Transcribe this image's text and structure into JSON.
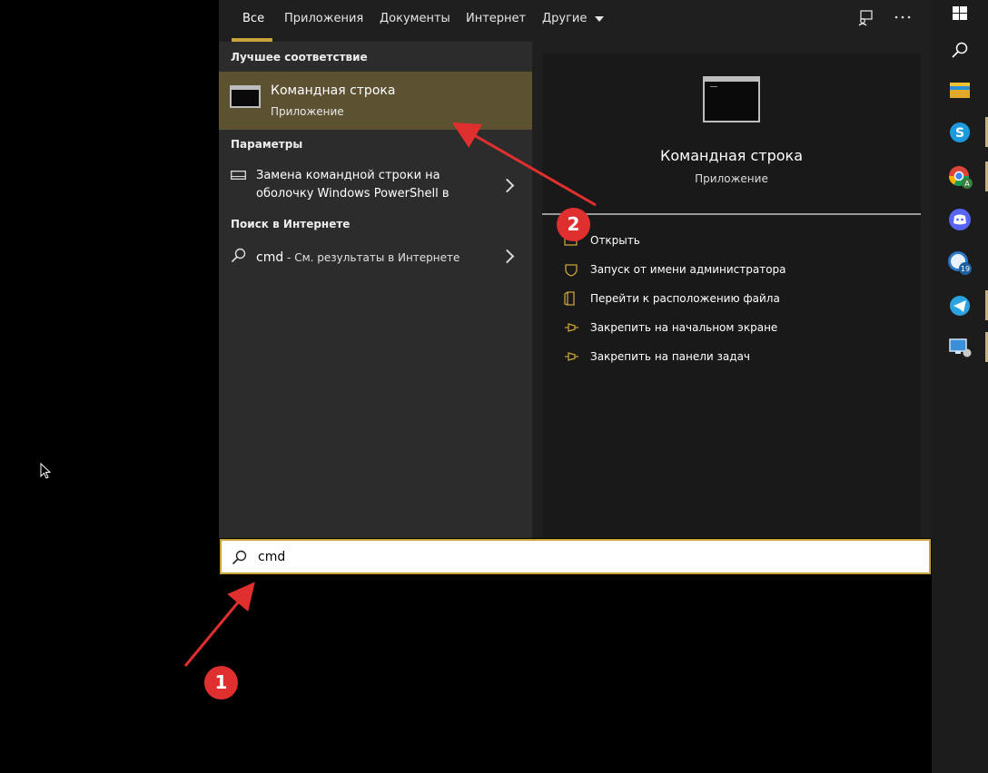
{
  "tabs": [
    {
      "label": "Все"
    },
    {
      "label": "Приложения"
    },
    {
      "label": "Документы"
    },
    {
      "label": "Интернет"
    },
    {
      "label": "Другие"
    }
  ],
  "accent_color": "#c8a33a",
  "sections": {
    "best_match": "Лучшее соответствие",
    "settings": "Параметры",
    "web": "Поиск в Интернете"
  },
  "best_match": {
    "title": "Командная строка",
    "subtitle": "Приложение"
  },
  "settings_item": {
    "line1": "Замена командной строки на",
    "line2": "оболочку Windows PowerShell в"
  },
  "web_item": {
    "query": "cmd",
    "suffix": " - См. результаты в Интернете"
  },
  "detail": {
    "title": "Командная строка",
    "subtitle": "Приложение",
    "actions": [
      {
        "label": "Открыть",
        "icon": "open-icon"
      },
      {
        "label": "Запуск от имени администратора",
        "icon": "shield-icon"
      },
      {
        "label": "Перейти к расположению файла",
        "icon": "folder-icon"
      },
      {
        "label": "Закрепить на начальном экране",
        "icon": "pin-icon"
      },
      {
        "label": "Закрепить на панели задач",
        "icon": "pin-icon"
      }
    ]
  },
  "search": {
    "value": "cmd"
  },
  "annotations": {
    "one": "1",
    "two": "2"
  },
  "taskbar_icons": [
    "windows-icon",
    "search-icon",
    "file-explorer-icon",
    "skype-icon",
    "chrome-icon",
    "discord-icon",
    "weather-icon",
    "telegram-icon",
    "remote-desktop-icon"
  ],
  "taskbar_badges": {
    "weather": "19",
    "chrome": "A"
  }
}
